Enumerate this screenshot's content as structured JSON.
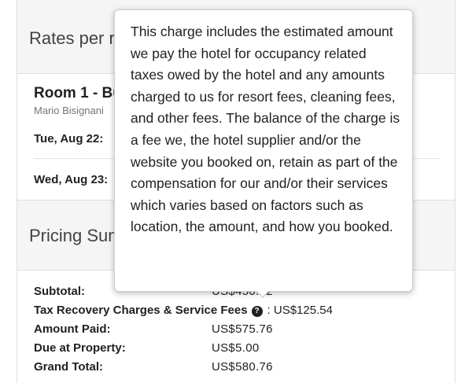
{
  "rates_section": {
    "title": "Rates per room"
  },
  "room": {
    "title": "Room 1 - Bu",
    "guest": "Mario Bisignani",
    "nights": [
      {
        "date": "Tue, Aug 22:"
      },
      {
        "date": "Wed, Aug 23:"
      }
    ]
  },
  "pricing_section": {
    "title": "Pricing Summary"
  },
  "summary": {
    "subtotal_label": "Subtotal:",
    "subtotal_value": "US$450.22",
    "tax_label": "Tax Recovery Charges & Service Fees",
    "tax_value": ": US$125.54",
    "amount_paid_label": "Amount Paid:",
    "amount_paid_value": "US$575.76",
    "due_label": "Due at Property:",
    "due_value": "US$5.00",
    "grand_total_label": "Grand Total:",
    "grand_total_value": "US$580.76"
  },
  "tooltip": {
    "text": "This charge includes the estimated amount we pay the hotel for occupancy related taxes owed by the hotel and any amounts charged to us for resort fees, cleaning fees, and other fees. The balance of the charge is a fee we, the hotel supplier and/or the website you booked on, retain as part of the compensation for our and/or their services which varies based on factors such as location, the amount, and how you booked."
  },
  "icons": {
    "help_icon": "question-circle",
    "help_glyph": "?"
  }
}
